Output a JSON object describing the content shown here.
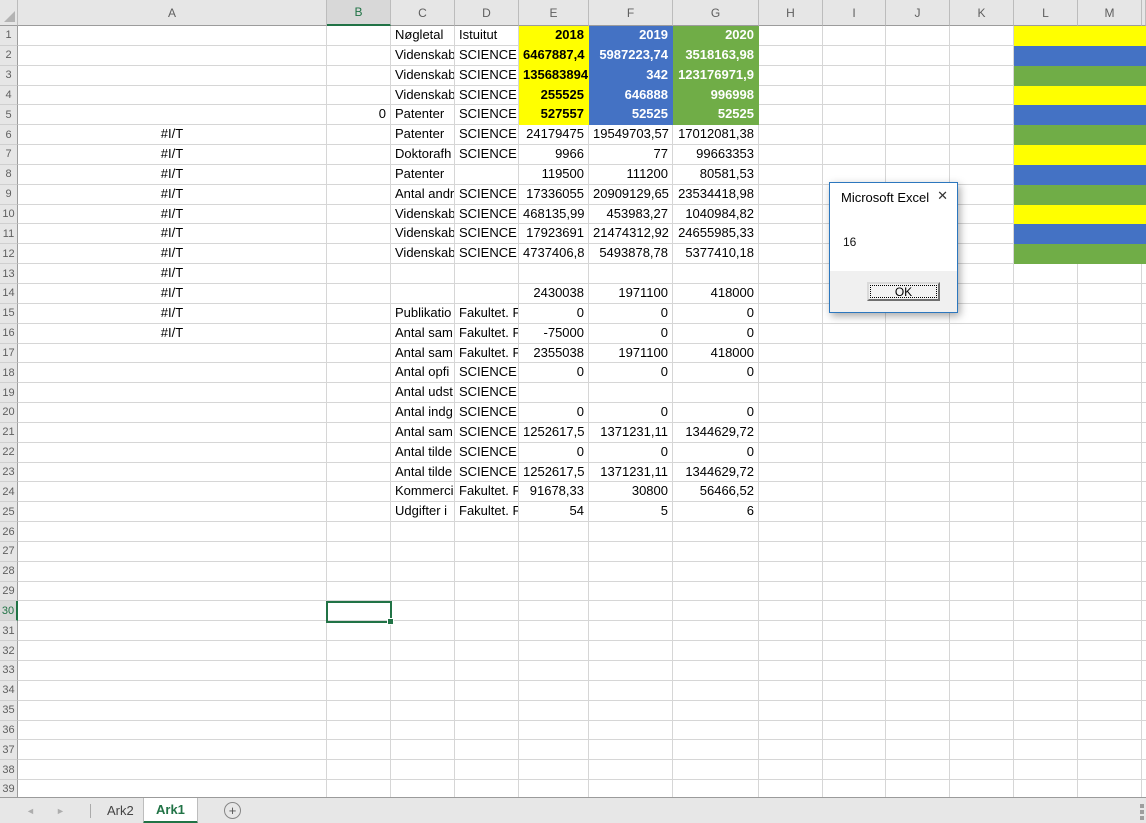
{
  "colors": {
    "yellow": "#FFFF00",
    "blue": "#4472C4",
    "green": "#70AD47",
    "accent": "#217346"
  },
  "columns": [
    "A",
    "B",
    "C",
    "D",
    "E",
    "F",
    "G",
    "H",
    "I",
    "J",
    "K",
    "L",
    "M"
  ],
  "selection": {
    "cell": "B30",
    "column": "B",
    "row": 30
  },
  "grid": {
    "rows": [
      {
        "n": 1,
        "cells": {
          "C": "Nøgletal",
          "D": "Istuitut",
          "E": "2018",
          "F": "2019",
          "G": "2020"
        },
        "efg_fill": true,
        "lm_fill": "yellow"
      },
      {
        "n": 2,
        "cells": {
          "C": "Videnskab",
          "D": "SCIENCE",
          "E": "6467887,4",
          "F": "5987223,74",
          "G": "3518163,98"
        },
        "efg_fill": true,
        "lm_fill": "blue"
      },
      {
        "n": 3,
        "cells": {
          "C": "Videnskab",
          "D": "SCIENCE",
          "E": "135683894",
          "F": "342",
          "G": "123176971,9"
        },
        "efg_fill": true,
        "lm_fill": "green"
      },
      {
        "n": 4,
        "cells": {
          "C": "Videnskab",
          "D": "SCIENCE",
          "E": "255525",
          "F": "646888",
          "G": "996998"
        },
        "efg_fill": true,
        "lm_fill": "yellow"
      },
      {
        "n": 5,
        "cells": {
          "B": "0",
          "C": "Patenter",
          "D": "SCIENCE",
          "E": "527557",
          "F": "52525",
          "G": "52525"
        },
        "efg_fill": true,
        "lm_fill": "blue"
      },
      {
        "n": 6,
        "cells": {
          "A": "#I/T",
          "C": "Patenter",
          "D": "SCIENCE",
          "E": "24179475",
          "F": "19549703,57",
          "G": "17012081,38"
        },
        "lm_fill": "green"
      },
      {
        "n": 7,
        "cells": {
          "A": "#I/T",
          "C": "Doktorafh",
          "D": "SCIENCE",
          "E": "9966",
          "F": "77",
          "G": "99663353"
        },
        "lm_fill": "yellow"
      },
      {
        "n": 8,
        "cells": {
          "A": "#I/T",
          "C": "Patenter",
          "E": "119500",
          "F": "111200",
          "G": "80581,53"
        },
        "lm_fill": "blue"
      },
      {
        "n": 9,
        "cells": {
          "A": "#I/T",
          "C": "Antal andr",
          "D": "SCIENCE",
          "E": "17336055",
          "F": "20909129,65",
          "G": "23534418,98"
        },
        "lm_fill": "green"
      },
      {
        "n": 10,
        "cells": {
          "A": "#I/T",
          "C": "Videnskab",
          "D": "SCIENCE",
          "E": "468135,99",
          "F": "453983,27",
          "G": "1040984,82"
        },
        "lm_fill": "yellow"
      },
      {
        "n": 11,
        "cells": {
          "A": "#I/T",
          "C": "Videnskab",
          "D": "SCIENCE",
          "E": "17923691",
          "F": "21474312,92",
          "G": "24655985,33"
        },
        "lm_fill": "blue"
      },
      {
        "n": 12,
        "cells": {
          "A": "#I/T",
          "C": "Videnskab",
          "D": "SCIENCE",
          "E": "4737406,8",
          "F": "5493878,78",
          "G": "5377410,18"
        },
        "lm_fill": "green"
      },
      {
        "n": 13,
        "cells": {
          "A": "#I/T"
        }
      },
      {
        "n": 14,
        "cells": {
          "A": "#I/T",
          "E": "2430038",
          "F": "1971100",
          "G": "418000"
        }
      },
      {
        "n": 15,
        "cells": {
          "A": "#I/T",
          "C": "Publikatio",
          "D": "Fakultet. F",
          "E": "0",
          "F": "0",
          "G": "0"
        }
      },
      {
        "n": 16,
        "cells": {
          "A": "#I/T",
          "C": "Antal sam",
          "D": "Fakultet. F",
          "E": "-75000",
          "F": "0",
          "G": "0"
        }
      },
      {
        "n": 17,
        "cells": {
          "C": "Antal sam",
          "D": "Fakultet. F",
          "E": "2355038",
          "F": "1971100",
          "G": "418000"
        }
      },
      {
        "n": 18,
        "cells": {
          "C": "Antal opfi",
          "D": "SCIENCE",
          "E": "0",
          "F": "0",
          "G": "0"
        }
      },
      {
        "n": 19,
        "cells": {
          "C": "Antal udst",
          "D": "SCIENCE"
        }
      },
      {
        "n": 20,
        "cells": {
          "C": "Antal indg",
          "D": "SCIENCE",
          "E": "0",
          "F": "0",
          "G": "0"
        }
      },
      {
        "n": 21,
        "cells": {
          "C": "Antal sam",
          "D": "SCIENCE",
          "E": "1252617,5",
          "F": "1371231,11",
          "G": "1344629,72"
        }
      },
      {
        "n": 22,
        "cells": {
          "C": "Antal tilde",
          "D": "SCIENCE",
          "E": "0",
          "F": "0",
          "G": "0"
        }
      },
      {
        "n": 23,
        "cells": {
          "C": "Antal tilde",
          "D": "SCIENCE",
          "E": "1252617,5",
          "F": "1371231,11",
          "G": "1344629,72"
        }
      },
      {
        "n": 24,
        "cells": {
          "C": "Kommerci",
          "D": "Fakultet. F",
          "E": "91678,33",
          "F": "30800",
          "G": "56466,52"
        }
      },
      {
        "n": 25,
        "cells": {
          "C": "Udgifter i",
          "D": "Fakultet. F",
          "E": "54",
          "F": "5",
          "G": "6"
        }
      }
    ],
    "visible_row_count": 39
  },
  "dialog": {
    "title": "Microsoft Excel",
    "message": "16",
    "ok_label": "OK",
    "close_glyph": "✕"
  },
  "sheet_tabs": {
    "nav_left_glyph": "◄",
    "nav_right_glyph": "►",
    "tabs": [
      {
        "label": "Ark2",
        "active": false
      },
      {
        "label": "Ark1",
        "active": true
      }
    ],
    "add_glyph": "+"
  }
}
